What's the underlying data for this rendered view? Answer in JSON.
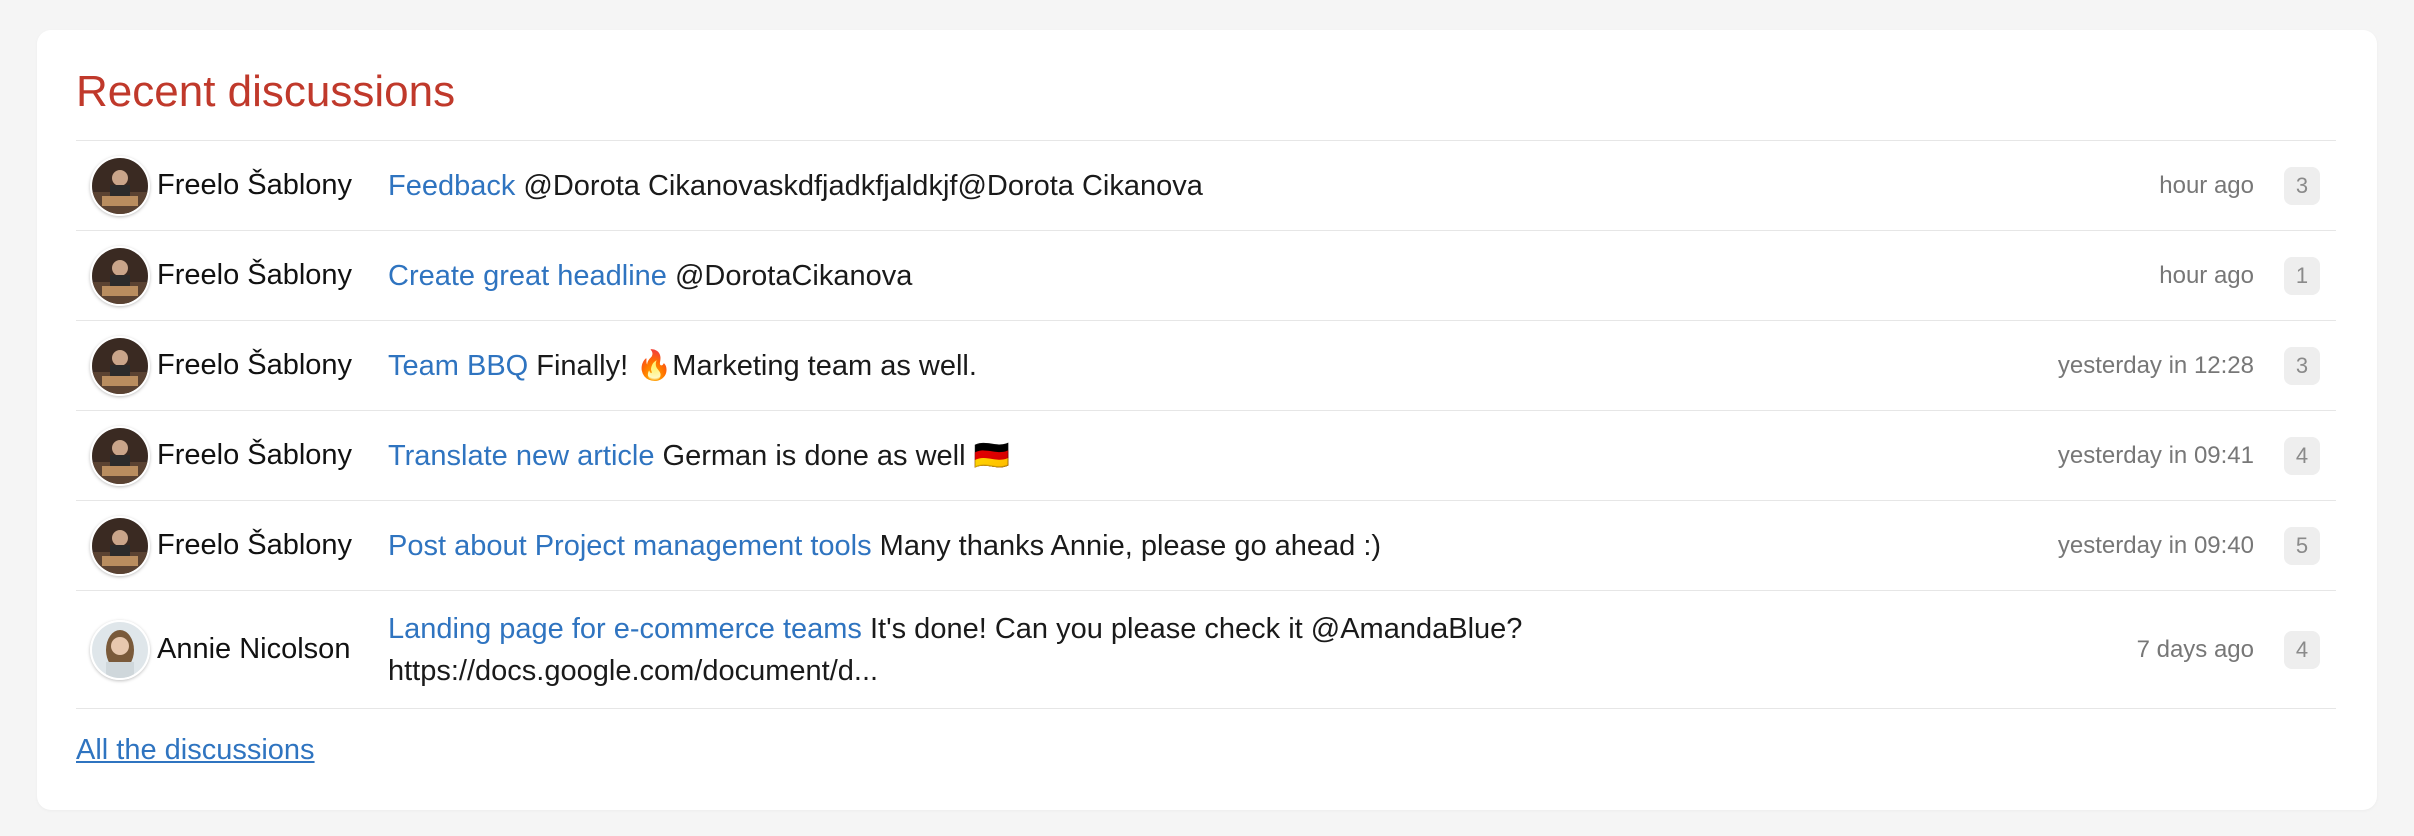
{
  "panel": {
    "title": "Recent discussions",
    "all_link": "All the discussions"
  },
  "colors": {
    "title": "#c0392b",
    "link": "#2f74c0",
    "badge_bg": "#eeeeee"
  },
  "discussions": [
    {
      "author": "Freelo Šablony",
      "avatar": "avatar-freelo",
      "topic": "Feedback",
      "message": " @Dorota Cikanovaskdfjadkfjaldkjf@Dorota Cikanova",
      "time": "hour ago",
      "count": "3"
    },
    {
      "author": "Freelo Šablony",
      "avatar": "avatar-freelo",
      "topic": "Create great headline",
      "message": " @DorotaCikanova",
      "time": "hour ago",
      "count": "1"
    },
    {
      "author": "Freelo Šablony",
      "avatar": "avatar-freelo",
      "topic": "Team BBQ",
      "message": " Finally! 🔥Marketing team as well.",
      "time": "yesterday in 12:28",
      "count": "3"
    },
    {
      "author": "Freelo Šablony",
      "avatar": "avatar-freelo",
      "topic": "Translate new article",
      "message": " German is done as well 🇩🇪",
      "time": "yesterday in 09:41",
      "count": "4"
    },
    {
      "author": "Freelo Šablony",
      "avatar": "avatar-freelo",
      "topic": "Post about Project management tools",
      "message": " Many thanks Annie, please go ahead :)",
      "time": "yesterday in 09:40",
      "count": "5"
    },
    {
      "author": "Annie Nicolson",
      "avatar": "avatar-annie",
      "topic": "Landing page for e-commerce teams",
      "message": " It's done! Can you please check it @AmandaBlue? https://docs.google.com/document/d...",
      "time": "7 days ago",
      "count": "4"
    }
  ]
}
